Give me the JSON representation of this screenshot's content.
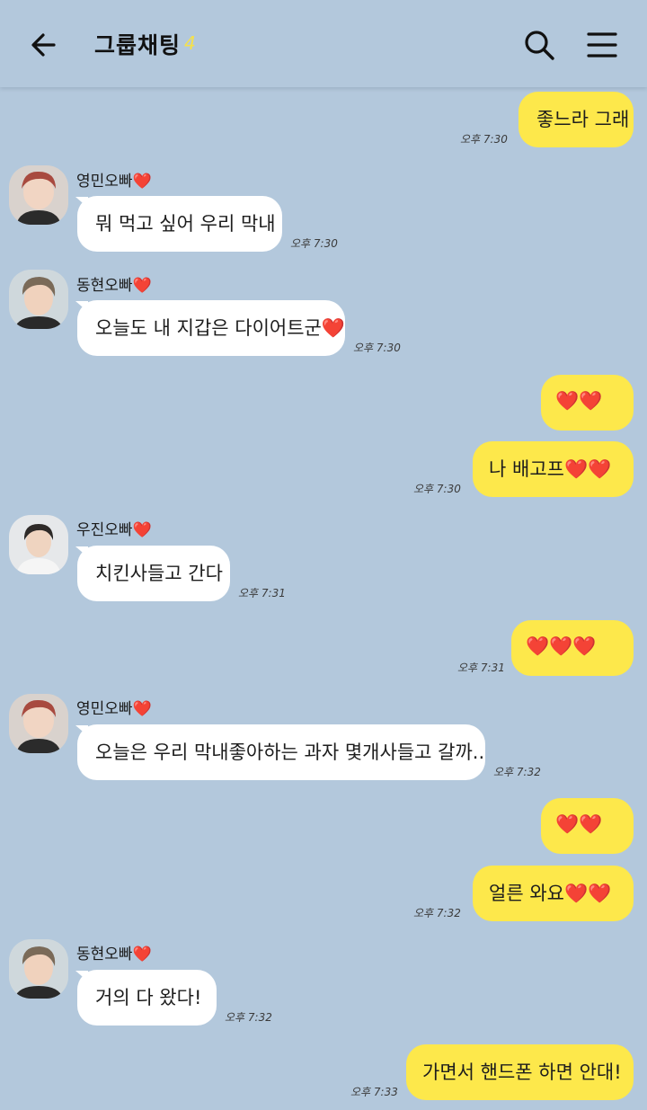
{
  "header": {
    "title": "그룹채팅",
    "count": "4"
  },
  "messages": [
    {
      "side": "me",
      "text": "좋느라 그래",
      "time": "오후 7:30"
    },
    {
      "side": "other",
      "sender": "영민오빠❤️",
      "text": "뭐 먹고 싶어 우리 막내",
      "time": "오후 7:30"
    },
    {
      "side": "other",
      "sender": "동현오빠❤️",
      "text": "오늘도 내 지갑은 다이어트군❤️",
      "time": "오후 7:30"
    },
    {
      "side": "me",
      "text": "❤️❤️",
      "time": ""
    },
    {
      "side": "me",
      "text": "나 배고프❤️❤️",
      "time": "오후 7:30"
    },
    {
      "side": "other",
      "sender": "우진오빠❤️",
      "text": "치킨사들고 간다",
      "time": "오후 7:31"
    },
    {
      "side": "me",
      "text": "❤️❤️❤️",
      "time": "오후 7:31"
    },
    {
      "side": "other",
      "sender": "영민오빠❤️",
      "text": "오늘은 우리 막내좋아하는 과자 몇개사들고 갈까...",
      "time": "오후 7:32"
    },
    {
      "side": "me",
      "text": "❤️❤️",
      "time": ""
    },
    {
      "side": "me",
      "text": "얼른 와요❤️❤️",
      "time": "오후 7:32"
    },
    {
      "side": "other",
      "sender": "동현오빠❤️",
      "text": "거의 다 왔다!",
      "time": "오후 7:32"
    },
    {
      "side": "me",
      "text": "가면서 핸드폰 하면 안대!",
      "time": "오후 7:33"
    }
  ],
  "avatars": {
    "yeongmin": "avatar-photo",
    "donghyun": "avatar-photo",
    "woojin": "avatar-photo"
  }
}
